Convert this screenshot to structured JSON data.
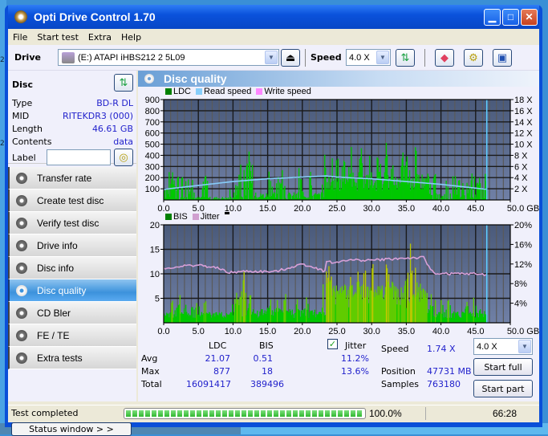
{
  "window": {
    "title": "Opti Drive Control 1.70"
  },
  "menu": [
    "File",
    "Start test",
    "Extra",
    "Help"
  ],
  "toolbar": {
    "drive_label": "Drive",
    "drive_value": "(E:)  ATAPI iHBS212   2 5L09",
    "speed_label": "Speed",
    "speed_value": "4.0 X"
  },
  "disc": {
    "heading": "Disc",
    "rows": [
      {
        "label": "Type",
        "value": "BD-R DL"
      },
      {
        "label": "MID",
        "value": "RITEKDR3 (000)"
      },
      {
        "label": "Length",
        "value": "46.61 GB"
      },
      {
        "label": "Contents",
        "value": "data"
      }
    ],
    "label_field_label": "Label",
    "label_field_value": ""
  },
  "nav": [
    {
      "label": "Transfer rate",
      "active": false
    },
    {
      "label": "Create test disc",
      "active": false
    },
    {
      "label": "Verify test disc",
      "active": false
    },
    {
      "label": "Drive info",
      "active": false
    },
    {
      "label": "Disc info",
      "active": false
    },
    {
      "label": "Disc quality",
      "active": true
    },
    {
      "label": "CD Bler",
      "active": false
    },
    {
      "label": "FE / TE",
      "active": false
    },
    {
      "label": "Extra tests",
      "active": false
    }
  ],
  "status_window_button": "Status window > >",
  "panel": {
    "title": "Disc quality"
  },
  "chart_data": [
    {
      "type": "bar",
      "title": "LDC / Read speed",
      "legend": [
        "LDC",
        "Read speed",
        "Write speed"
      ],
      "legend_colors": [
        "#008000",
        "#87cefa",
        "#ff88ff"
      ],
      "x_ticks": [
        "0.0",
        "5.0",
        "10.0",
        "15.0",
        "20.0",
        "25.0",
        "30.0",
        "35.0",
        "40.0",
        "45.0",
        "50.0 GB"
      ],
      "xlim": [
        0,
        50
      ],
      "y_left_ticks": [
        "100",
        "200",
        "300",
        "400",
        "500",
        "600",
        "700",
        "800",
        "900"
      ],
      "ylim_left": [
        0,
        900
      ],
      "y_right_ticks": [
        "2 X",
        "4 X",
        "6 X",
        "8 X",
        "10 X",
        "12 X",
        "14 X",
        "16 X",
        "18 X"
      ],
      "ylim_right": [
        0,
        18
      ],
      "disc_end_gb": 46.61,
      "ldc_peaks": [
        [
          0.2,
          180
        ],
        [
          0.8,
          330
        ],
        [
          1.2,
          300
        ],
        [
          2.3,
          370
        ],
        [
          3.5,
          330
        ],
        [
          4.0,
          200
        ],
        [
          6.0,
          290
        ],
        [
          10.5,
          200
        ],
        [
          11.2,
          540
        ],
        [
          12.0,
          650
        ],
        [
          12.5,
          500
        ],
        [
          15.2,
          320
        ],
        [
          16.5,
          330
        ],
        [
          17.0,
          300
        ],
        [
          19.5,
          310
        ],
        [
          21.0,
          320
        ],
        [
          23.3,
          540
        ],
        [
          24.0,
          560
        ],
        [
          25.0,
          500
        ],
        [
          26.0,
          550
        ],
        [
          27.0,
          540
        ],
        [
          28.5,
          580
        ],
        [
          29.5,
          500
        ],
        [
          31.0,
          520
        ],
        [
          32.0,
          540
        ],
        [
          33.0,
          400
        ],
        [
          34.5,
          480
        ],
        [
          35.0,
          600
        ],
        [
          36.0,
          877
        ],
        [
          37.0,
          400
        ],
        [
          38.0,
          320
        ],
        [
          39.0,
          280
        ],
        [
          40.5,
          290
        ],
        [
          41.5,
          260
        ],
        [
          42.5,
          280
        ],
        [
          43.5,
          360
        ],
        [
          44.5,
          380
        ],
        [
          45.5,
          300
        ],
        [
          46.3,
          230
        ]
      ],
      "read_speed_x": [
        0,
        5,
        10,
        15,
        20,
        23.5,
        25,
        30,
        35,
        40,
        46.6
      ],
      "read_speed_y": [
        1.9,
        2.6,
        3.3,
        3.8,
        4.1,
        4.3,
        4.1,
        3.8,
        3.3,
        2.8,
        1.9
      ]
    },
    {
      "type": "bar",
      "title": "BIS / Jitter",
      "legend": [
        "BIS",
        "Jitter"
      ],
      "legend_colors": [
        "#008000",
        "#d0a0d0"
      ],
      "x_ticks": [
        "0.0",
        "5.0",
        "10.0",
        "15.0",
        "20.0",
        "25.0",
        "30.0",
        "35.0",
        "40.0",
        "45.0",
        "50.0 GB"
      ],
      "xlim": [
        0,
        50
      ],
      "y_left_ticks": [
        "5",
        "10",
        "15",
        "20"
      ],
      "ylim_left": [
        0,
        20
      ],
      "y_right_ticks": [
        "4%",
        "8%",
        "12%",
        "16%",
        "20%"
      ],
      "ylim_right": [
        0,
        20
      ],
      "bis_peaks": [
        [
          0.3,
          3
        ],
        [
          1.0,
          6
        ],
        [
          1.5,
          5
        ],
        [
          2.3,
          6
        ],
        [
          3.0,
          5
        ],
        [
          3.8,
          6
        ],
        [
          4.5,
          5
        ],
        [
          6.0,
          5
        ],
        [
          10.5,
          8
        ],
        [
          11.0,
          9
        ],
        [
          11.5,
          11
        ],
        [
          12.0,
          12
        ],
        [
          12.5,
          8
        ],
        [
          15.2,
          6
        ],
        [
          16.5,
          6
        ],
        [
          17.5,
          7
        ],
        [
          19.2,
          5
        ],
        [
          20.5,
          6
        ],
        [
          23.3,
          16
        ],
        [
          23.6,
          17
        ],
        [
          24.0,
          13
        ],
        [
          25.0,
          10
        ],
        [
          26.0,
          13
        ],
        [
          27.0,
          12
        ],
        [
          28.0,
          11
        ],
        [
          29.0,
          16
        ],
        [
          30.0,
          13
        ],
        [
          31.0,
          12
        ],
        [
          32.0,
          13
        ],
        [
          33.0,
          12
        ],
        [
          34.5,
          11
        ],
        [
          35.0,
          13
        ],
        [
          35.5,
          18
        ],
        [
          36.5,
          10
        ],
        [
          37.5,
          9
        ],
        [
          38.5,
          6
        ],
        [
          40.0,
          5
        ],
        [
          41.0,
          6
        ],
        [
          42.0,
          5
        ],
        [
          43.5,
          6
        ],
        [
          44.6,
          8
        ],
        [
          45.5,
          4
        ],
        [
          46.3,
          3
        ]
      ],
      "jitter_x": [
        0,
        2,
        5,
        7,
        8.5,
        9,
        12,
        16,
        20,
        22,
        23.2,
        23.5,
        25,
        26,
        30,
        35,
        37.5,
        38.2,
        38.5,
        39,
        40,
        45,
        46.6
      ],
      "jitter_y": [
        11,
        11.5,
        11.8,
        11.3,
        11.0,
        10.2,
        10.5,
        10.4,
        12.0,
        11.2,
        10.5,
        12.5,
        12.2,
        12.8,
        12.8,
        13.2,
        13.3,
        11.5,
        11.0,
        10.2,
        10.0,
        10.0,
        9.8
      ]
    }
  ],
  "stats": {
    "col_ldc": "LDC",
    "col_bis": "BIS",
    "jitter_label": "Jitter",
    "jitter_checked": true,
    "rows": [
      {
        "label": "Avg",
        "ldc": "21.07",
        "bis": "0.51",
        "jitter": "11.2%"
      },
      {
        "label": "Max",
        "ldc": "877",
        "bis": "18",
        "jitter": "13.6%"
      },
      {
        "label": "Total",
        "ldc": "16091417",
        "bis": "389496",
        "jitter": ""
      }
    ],
    "speed_label": "Speed",
    "speed_value": "1.74 X",
    "position_label": "Position",
    "position_value": "47731 MB",
    "samples_label": "Samples",
    "samples_value": "763180",
    "speed_select": "4.0 X",
    "start_full": "Start full",
    "start_part": "Start part"
  },
  "statusbar": {
    "message": "Test completed",
    "progress_percent": 100.0,
    "progress_text": "100.0%",
    "elapsed": "66:28"
  }
}
